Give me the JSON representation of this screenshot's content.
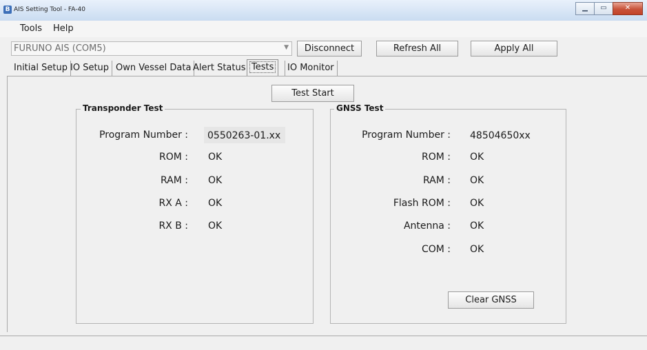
{
  "window": {
    "title": "AIS Setting Tool - FA-40",
    "buttons": {
      "minimize": "▁",
      "maximize": "▭",
      "close": "✕"
    }
  },
  "menu": {
    "items": [
      "Tools",
      "Help"
    ]
  },
  "connection": {
    "device": "FURUNO AIS (COM5)",
    "disconnect_label": "Disconnect",
    "refresh_label": "Refresh All",
    "apply_label": "Apply All"
  },
  "tabs": [
    {
      "label": "Initial Setup"
    },
    {
      "label": "IO Setup"
    },
    {
      "label": "Own Vessel Data"
    },
    {
      "label": "Alert Status"
    },
    {
      "label": "Tests",
      "active": true
    },
    {
      "label": "IO Monitor"
    }
  ],
  "tests": {
    "start_label": "Test Start",
    "transponder": {
      "title": "Transponder Test",
      "rows": [
        {
          "label": "Program Number :",
          "value": "0550263-01.xx"
        },
        {
          "label": "ROM :",
          "value": "OK"
        },
        {
          "label": "RAM :",
          "value": "OK"
        },
        {
          "label": "RX A :",
          "value": "OK"
        },
        {
          "label": "RX B :",
          "value": "OK"
        }
      ]
    },
    "gnss": {
      "title": "GNSS Test",
      "rows": [
        {
          "label": "Program Number :",
          "value": "48504650xx"
        },
        {
          "label": "ROM :",
          "value": "OK"
        },
        {
          "label": "RAM :",
          "value": "OK"
        },
        {
          "label": "Flash ROM :",
          "value": "OK"
        },
        {
          "label": "Antenna :",
          "value": "OK"
        },
        {
          "label": "COM :",
          "value": "OK"
        }
      ],
      "clear_label": "Clear GNSS"
    }
  }
}
